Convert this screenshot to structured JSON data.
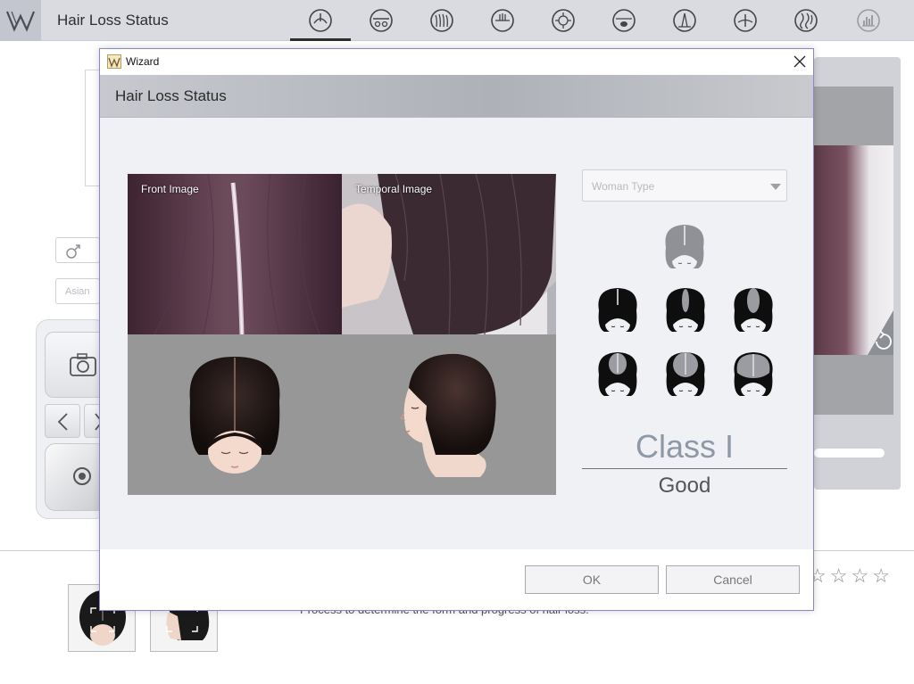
{
  "app": {
    "title": "Hair Loss Status",
    "nav_icons": [
      "scalp-type-icon",
      "scalp-condition-icon",
      "hair-density-icon",
      "pore-icon",
      "sebum-icon",
      "dandruff-icon",
      "thickness-icon",
      "hair-loss-icon",
      "damage-icon",
      "chart-icon"
    ]
  },
  "background": {
    "race_placeholder": "Asian",
    "description": "Process to determine the form and progress of hair loss."
  },
  "dialog": {
    "window_title": "Wizard",
    "header_title": "Hair Loss Status",
    "front_image_label": "Front Image",
    "temporal_image_label": "Temporal Image",
    "type_select_placeholder": "Woman Type",
    "class_label": "Class I",
    "status_label": "Good",
    "ok_label": "OK",
    "cancel_label": "Cancel"
  },
  "colors": {
    "accent": "#8a86c8",
    "class_text": "#8e98a6",
    "selected_grade": "#8f9196"
  }
}
